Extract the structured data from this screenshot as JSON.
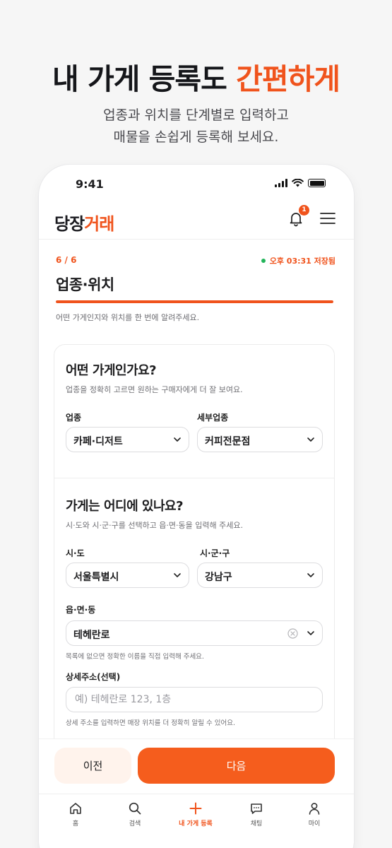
{
  "hero": {
    "title_main": "내 가게 등록도 ",
    "title_accent": "간편하게",
    "subtitle_line1": "업종과 위치를 단계별로 입력하고",
    "subtitle_line2": "매물을 손쉽게 등록해 보세요."
  },
  "status_bar": {
    "time": "9:41",
    "icons": [
      "signal-icon",
      "wifi-icon",
      "battery-icon"
    ]
  },
  "app": {
    "logo_part1": "당장",
    "logo_part2": "거래",
    "notification_count": "1",
    "icons": [
      "bell-icon",
      "menu-icon"
    ]
  },
  "progress": {
    "step": "6 / 6",
    "saved_label": "오후 03:31 저장됨",
    "section_title": "업종·위치",
    "completion": 1.0,
    "description": "어떤 가게인지와 위치를 한 번에 알려주세요."
  },
  "business": {
    "title": "어떤 가게인가요?",
    "desc": "업종을 정확히 고르면 원하는 구매자에게 더 잘 보여요.",
    "category_label": "업종",
    "category_value": "카페·디저트",
    "subcategory_label": "세부업종",
    "subcategory_value": "커피전문점"
  },
  "location": {
    "title": "가게는 어디에 있나요?",
    "desc": "시·도와 시·군·구를 선택하고 읍·면·동을 입력해 주세요.",
    "sido_label": "시·도",
    "sido_value": "서울특별시",
    "sigungu_label": "시·군·구",
    "sigungu_value": "강남구",
    "dong_label": "읍·면·동",
    "dong_value": "테헤란로",
    "dong_hint": "목록에 없으면 정확한 이름을 직접 입력해 주세요.",
    "detail_label": "상세주소(선택)",
    "detail_placeholder": "예) 테헤란로 123, 1층",
    "detail_hint": "상세 주소를 입력하면 매장 위치를 더 정확히 알릴 수 있어요."
  },
  "actions": {
    "prev": "이전",
    "next": "다음"
  },
  "tabbar": {
    "home": "홈",
    "search": "검색",
    "register": "내 가게 등록",
    "chat": "채팅",
    "my": "마이"
  },
  "colors": {
    "accent": "#f0531c",
    "saved_dot": "#22b45a"
  }
}
